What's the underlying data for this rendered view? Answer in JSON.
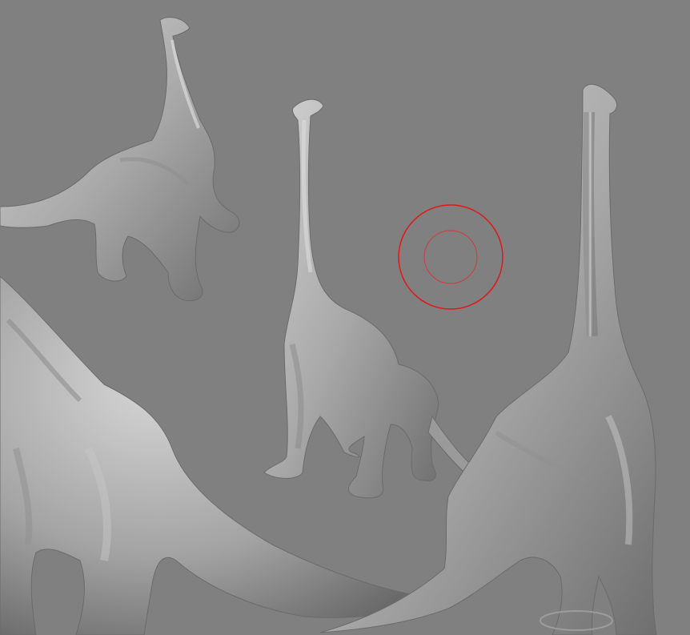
{
  "viewport": {
    "background_color": "#808080",
    "model_color": "#b4b4b4",
    "brush_cursor_color": "#e01818",
    "models": [
      {
        "name": "brachiosaurus-sculpt-top-left"
      },
      {
        "name": "brachiosaurus-sculpt-center"
      },
      {
        "name": "brachiosaurus-sculpt-right"
      },
      {
        "name": "brachiosaurus-sculpt-foreground-left"
      }
    ],
    "brush_cursor": {
      "icon": "brush-radius-circle-icon"
    }
  }
}
